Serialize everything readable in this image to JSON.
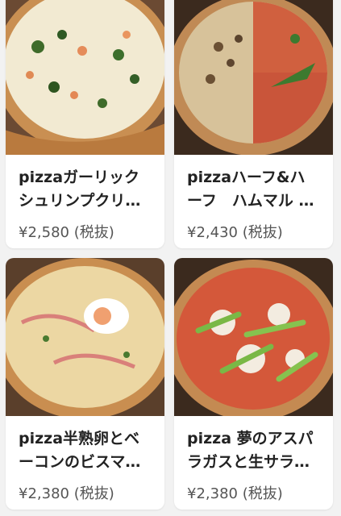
{
  "menu": {
    "items": [
      {
        "title_lines": [
          "pizzaガーリック",
          "シュリンプクリ…"
        ],
        "price": "¥2,580 (税抜)",
        "photo": "garlic-shrimp-cream-pizza"
      },
      {
        "title_lines": [
          "pizzaハーフ&ハ",
          "ーフ　ハムマル …"
        ],
        "price": "¥2,430 (税抜)",
        "photo": "half-and-half-pizza"
      },
      {
        "title_lines": [
          "pizza半熟卵とベ",
          "ーコンのビスマ…"
        ],
        "price": "¥2,380 (税抜)",
        "photo": "soft-egg-bacon-bismarck-pizza"
      },
      {
        "title_lines": [
          "pizza 夢のアスパ",
          "ラガスと生サラ…"
        ],
        "price": "¥2,380 (税抜)",
        "photo": "asparagus-pizza"
      }
    ]
  },
  "colors": {
    "card_bg": "#ffffff",
    "page_bg": "#f2f2f2",
    "title": "#222222",
    "price": "#555555"
  }
}
